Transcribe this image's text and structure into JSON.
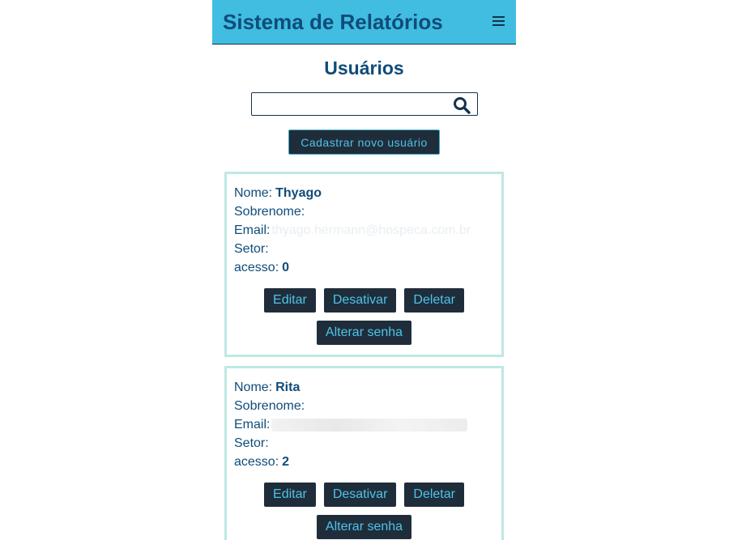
{
  "header": {
    "title": "Sistema de Relatórios",
    "menu_icon": "hamburger-menu-icon"
  },
  "page": {
    "title": "Usuários"
  },
  "search": {
    "placeholder": "",
    "value": "",
    "icon": "search-icon"
  },
  "new_user_button": "Cadastrar novo usuário",
  "field_labels": {
    "nome": "Nome:",
    "sobrenome": "Sobrenome:",
    "email": "Email:",
    "setor": "Setor:",
    "acesso": "acesso:"
  },
  "users": [
    {
      "nome": "Thyago",
      "sobrenome": "",
      "email": "thyago.hermann@hospeca.com.br",
      "setor": "",
      "acesso": "0"
    },
    {
      "nome": "Rita",
      "sobrenome": "",
      "email": "",
      "setor": "",
      "acesso": "2"
    }
  ],
  "actions": {
    "editar": "Editar",
    "desativar": "Desativar",
    "deletar": "Deletar",
    "alterar_senha": "Alterar senha"
  },
  "colors": {
    "header_bg": "#40bde0",
    "title_text": "#0f4c7a",
    "button_bg": "#1f2d3b",
    "button_text": "#4fc3e8",
    "card_border": "#bfe8e4"
  }
}
